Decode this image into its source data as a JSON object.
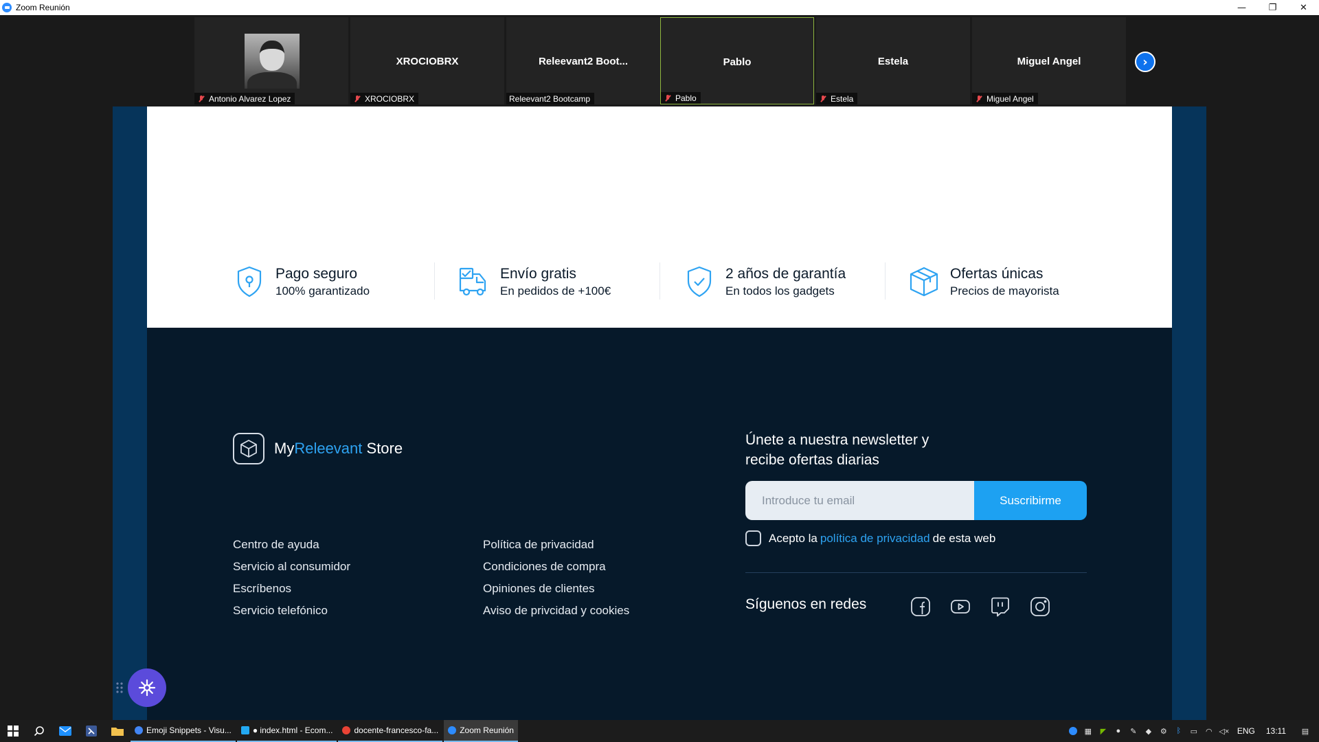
{
  "window": {
    "title": "Zoom Reunión",
    "minimize": "—",
    "restore": "❐",
    "close": "✕"
  },
  "participants": [
    {
      "name": "Antonio Alvarez Lopez",
      "center": "",
      "has_photo": true,
      "muted": true
    },
    {
      "name": "XROCIOBRX",
      "center": "XROCIOBRX",
      "muted": true
    },
    {
      "name": "Releevant2 Bootcamp",
      "center": "Releevant2  Boot...",
      "muted": false
    },
    {
      "name": "Pablo",
      "center": "Pablo",
      "muted": true,
      "active_speaker": true
    },
    {
      "name": "Estela",
      "center": "Estela",
      "muted": true
    },
    {
      "name": "Miguel Angel",
      "center": "Miguel Angel",
      "muted": true
    }
  ],
  "strip_next_icon": "›",
  "features": [
    {
      "icon": "shield-pin-icon",
      "title": "Pago seguro",
      "subtitle": "100% garantizado"
    },
    {
      "icon": "delivery-truck-icon",
      "title": "Envío gratis",
      "subtitle": "En pedidos de +100€"
    },
    {
      "icon": "shield-check-icon",
      "title": "2 años de garantía",
      "subtitle": "En todos los gadgets"
    },
    {
      "icon": "box-icon",
      "title": "Ofertas únicas",
      "subtitle": "Precios de mayorista"
    }
  ],
  "brand": {
    "prefix": "My",
    "accent": "Releevant",
    "suffix": " Store"
  },
  "links_col1": [
    "Centro de ayuda",
    "Servicio al consumidor",
    "Escríbenos",
    "Servicio telefónico"
  ],
  "links_col2": [
    "Política de privacidad",
    "Condiciones de compra",
    "Opiniones de clientes",
    "Aviso de privcidad y cookies"
  ],
  "newsletter": {
    "title": "Únete a nuestra newsletter y recibe ofertas diarias",
    "placeholder": "Introduce tu email",
    "button": "Suscribirme",
    "consent_prefix": "Acepto la",
    "consent_link": "política de privacidad",
    "consent_suffix": "de esta web"
  },
  "social": {
    "title": "Síguenos en redes",
    "icons": [
      "facebook-icon",
      "youtube-icon",
      "twitch-icon",
      "instagram-icon"
    ]
  },
  "taskbar": {
    "apps": [
      {
        "label": "Emoji Snippets - Visu...",
        "color": "#4285f4"
      },
      {
        "label": "● index.html - Ecom...",
        "color": "#23a9f2"
      },
      {
        "label": "docente-francesco-fa...",
        "color": "#ea4335"
      },
      {
        "label": "Zoom Reunión",
        "color": "#2d8cff",
        "active": true
      }
    ],
    "lang": "ENG",
    "time": "13:11"
  },
  "colors": {
    "accent": "#2ea3f2",
    "button": "#1da1f2",
    "footer_bg": "#06192a",
    "share_bg": "#06345a",
    "active_speaker_border": "#8fb63f"
  }
}
